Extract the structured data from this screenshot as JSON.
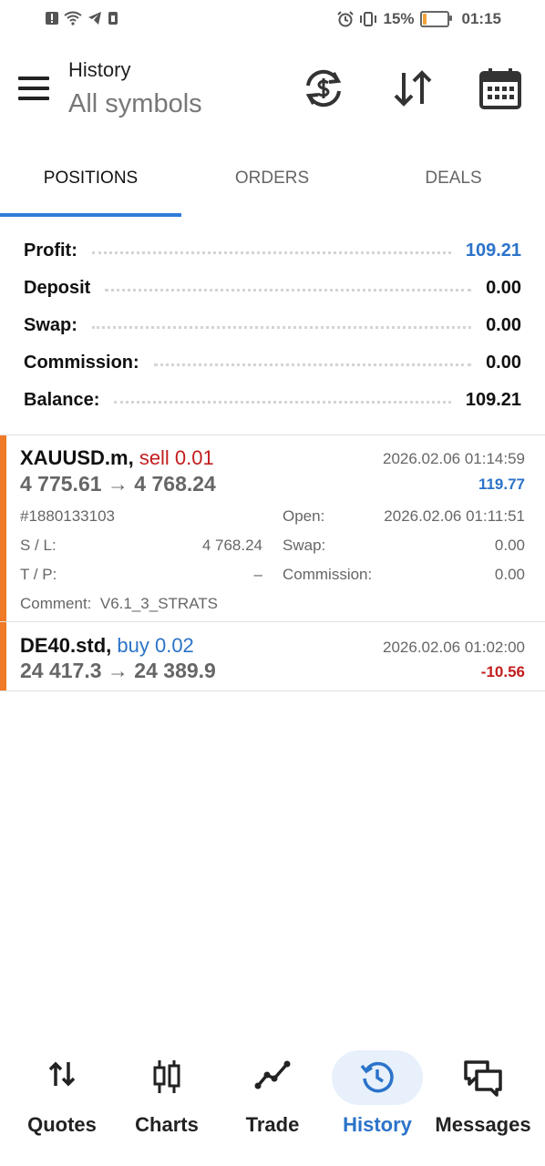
{
  "status_bar": {
    "battery": "15%",
    "time": "01:15"
  },
  "header": {
    "title": "History",
    "subtitle": "All symbols"
  },
  "tabs": [
    {
      "label": "POSITIONS",
      "active": true
    },
    {
      "label": "ORDERS",
      "active": false
    },
    {
      "label": "DEALS",
      "active": false
    }
  ],
  "summary": {
    "profit_label": "Profit:",
    "profit_value": "109.21",
    "deposit_label": "Deposit",
    "deposit_value": "0.00",
    "swap_label": "Swap:",
    "swap_value": "0.00",
    "commission_label": "Commission:",
    "commission_value": "0.00",
    "balance_label": "Balance:",
    "balance_value": "109.21"
  },
  "positions": [
    {
      "symbol": "XAUUSD.m,",
      "direction": "sell 0.01",
      "prices": "4 775.61 → 4 768.24",
      "close_time": "2026.02.06 01:14:59",
      "profit": "119.77",
      "ticket": "#1880133103",
      "open_label": "Open:",
      "open_time": "2026.02.06 01:11:51",
      "sl_label": "S / L:",
      "sl_value": "4 768.24",
      "swap_label": "Swap:",
      "swap_value": "0.00",
      "tp_label": "T / P:",
      "tp_value": "–",
      "commission_label": "Commission:",
      "commission_value": "0.00",
      "comment_label": "Comment:",
      "comment_value": "V6.1_3_STRATS"
    },
    {
      "symbol": "DE40.std,",
      "direction": "buy 0.02",
      "prices": "24 417.3 → 24 389.9",
      "close_time": "2026.02.06 01:02:00",
      "profit": "-10.56"
    }
  ],
  "bottom_nav": [
    {
      "label": "Quotes",
      "icon": "quotes-arrows-icon"
    },
    {
      "label": "Charts",
      "icon": "candlestick-icon"
    },
    {
      "label": "Trade",
      "icon": "trade-line-icon"
    },
    {
      "label": "History",
      "icon": "history-clock-icon",
      "active": true
    },
    {
      "label": "Messages",
      "icon": "messages-icon"
    }
  ],
  "colors": {
    "accent": "#2b73c9",
    "loss": "#c31d1d",
    "position_bar": "#f07a26"
  }
}
